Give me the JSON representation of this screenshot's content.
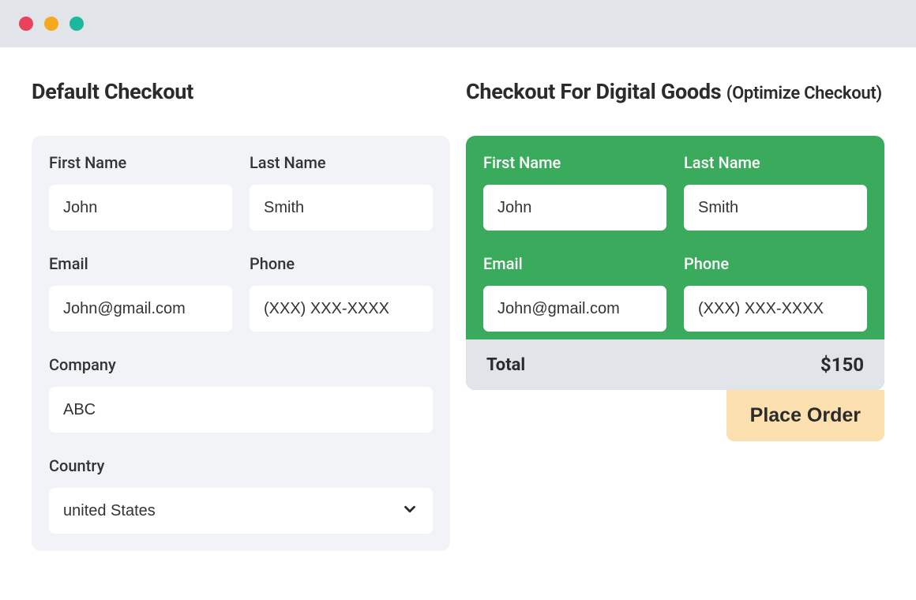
{
  "left": {
    "title": "Default Checkout",
    "fields": {
      "first_name": {
        "label": "First Name",
        "value": "John"
      },
      "last_name": {
        "label": "Last Name",
        "value": "Smith"
      },
      "email": {
        "label": "Email",
        "value": "John@gmail.com"
      },
      "phone": {
        "label": "Phone",
        "placeholder": "(XXX) XXX-XXXX"
      },
      "company": {
        "label": "Company",
        "value": "ABC"
      },
      "country": {
        "label": "Country",
        "value": "united States"
      }
    }
  },
  "right": {
    "title_main": "Checkout For Digital Goods ",
    "title_sub": "(Optimize Checkout)",
    "fields": {
      "first_name": {
        "label": "First Name",
        "value": "John"
      },
      "last_name": {
        "label": "Last Name",
        "value": "Smith"
      },
      "email": {
        "label": "Email",
        "value": "John@gmail.com"
      },
      "phone": {
        "label": "Phone",
        "placeholder": "(XXX) XXX-XXXX"
      }
    },
    "total_label": "Total",
    "total_value": "$150",
    "cta": "Place Order"
  }
}
